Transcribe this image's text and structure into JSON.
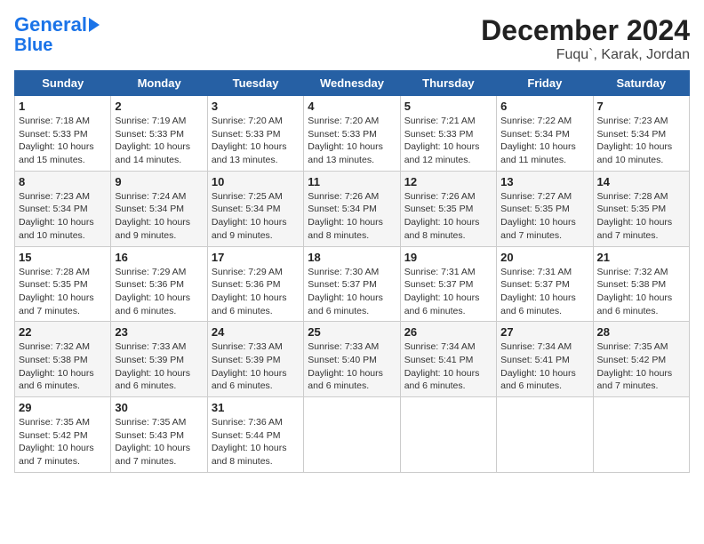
{
  "header": {
    "logo_line1": "General",
    "logo_line2": "Blue",
    "title": "December 2024",
    "subtitle": "Fuqu`, Karak, Jordan"
  },
  "calendar": {
    "days_of_week": [
      "Sunday",
      "Monday",
      "Tuesday",
      "Wednesday",
      "Thursday",
      "Friday",
      "Saturday"
    ],
    "weeks": [
      [
        null,
        {
          "day": "2",
          "sunrise": "7:19 AM",
          "sunset": "5:33 PM",
          "daylight": "10 hours and 14 minutes."
        },
        {
          "day": "3",
          "sunrise": "7:20 AM",
          "sunset": "5:33 PM",
          "daylight": "10 hours and 13 minutes."
        },
        {
          "day": "4",
          "sunrise": "7:20 AM",
          "sunset": "5:33 PM",
          "daylight": "10 hours and 13 minutes."
        },
        {
          "day": "5",
          "sunrise": "7:21 AM",
          "sunset": "5:33 PM",
          "daylight": "10 hours and 12 minutes."
        },
        {
          "day": "6",
          "sunrise": "7:22 AM",
          "sunset": "5:34 PM",
          "daylight": "10 hours and 11 minutes."
        },
        {
          "day": "7",
          "sunrise": "7:23 AM",
          "sunset": "5:34 PM",
          "daylight": "10 hours and 10 minutes."
        }
      ],
      [
        {
          "day": "1",
          "sunrise": "7:18 AM",
          "sunset": "5:33 PM",
          "daylight": "10 hours and 15 minutes."
        },
        null,
        null,
        null,
        null,
        null,
        null
      ],
      [
        {
          "day": "8",
          "sunrise": "7:23 AM",
          "sunset": "5:34 PM",
          "daylight": "10 hours and 10 minutes."
        },
        {
          "day": "9",
          "sunrise": "7:24 AM",
          "sunset": "5:34 PM",
          "daylight": "10 hours and 9 minutes."
        },
        {
          "day": "10",
          "sunrise": "7:25 AM",
          "sunset": "5:34 PM",
          "daylight": "10 hours and 9 minutes."
        },
        {
          "day": "11",
          "sunrise": "7:26 AM",
          "sunset": "5:34 PM",
          "daylight": "10 hours and 8 minutes."
        },
        {
          "day": "12",
          "sunrise": "7:26 AM",
          "sunset": "5:35 PM",
          "daylight": "10 hours and 8 minutes."
        },
        {
          "day": "13",
          "sunrise": "7:27 AM",
          "sunset": "5:35 PM",
          "daylight": "10 hours and 7 minutes."
        },
        {
          "day": "14",
          "sunrise": "7:28 AM",
          "sunset": "5:35 PM",
          "daylight": "10 hours and 7 minutes."
        }
      ],
      [
        {
          "day": "15",
          "sunrise": "7:28 AM",
          "sunset": "5:35 PM",
          "daylight": "10 hours and 7 minutes."
        },
        {
          "day": "16",
          "sunrise": "7:29 AM",
          "sunset": "5:36 PM",
          "daylight": "10 hours and 6 minutes."
        },
        {
          "day": "17",
          "sunrise": "7:29 AM",
          "sunset": "5:36 PM",
          "daylight": "10 hours and 6 minutes."
        },
        {
          "day": "18",
          "sunrise": "7:30 AM",
          "sunset": "5:37 PM",
          "daylight": "10 hours and 6 minutes."
        },
        {
          "day": "19",
          "sunrise": "7:31 AM",
          "sunset": "5:37 PM",
          "daylight": "10 hours and 6 minutes."
        },
        {
          "day": "20",
          "sunrise": "7:31 AM",
          "sunset": "5:37 PM",
          "daylight": "10 hours and 6 minutes."
        },
        {
          "day": "21",
          "sunrise": "7:32 AM",
          "sunset": "5:38 PM",
          "daylight": "10 hours and 6 minutes."
        }
      ],
      [
        {
          "day": "22",
          "sunrise": "7:32 AM",
          "sunset": "5:38 PM",
          "daylight": "10 hours and 6 minutes."
        },
        {
          "day": "23",
          "sunrise": "7:33 AM",
          "sunset": "5:39 PM",
          "daylight": "10 hours and 6 minutes."
        },
        {
          "day": "24",
          "sunrise": "7:33 AM",
          "sunset": "5:39 PM",
          "daylight": "10 hours and 6 minutes."
        },
        {
          "day": "25",
          "sunrise": "7:33 AM",
          "sunset": "5:40 PM",
          "daylight": "10 hours and 6 minutes."
        },
        {
          "day": "26",
          "sunrise": "7:34 AM",
          "sunset": "5:41 PM",
          "daylight": "10 hours and 6 minutes."
        },
        {
          "day": "27",
          "sunrise": "7:34 AM",
          "sunset": "5:41 PM",
          "daylight": "10 hours and 6 minutes."
        },
        {
          "day": "28",
          "sunrise": "7:35 AM",
          "sunset": "5:42 PM",
          "daylight": "10 hours and 7 minutes."
        }
      ],
      [
        {
          "day": "29",
          "sunrise": "7:35 AM",
          "sunset": "5:42 PM",
          "daylight": "10 hours and 7 minutes."
        },
        {
          "day": "30",
          "sunrise": "7:35 AM",
          "sunset": "5:43 PM",
          "daylight": "10 hours and 7 minutes."
        },
        {
          "day": "31",
          "sunrise": "7:36 AM",
          "sunset": "5:44 PM",
          "daylight": "10 hours and 8 minutes."
        },
        null,
        null,
        null,
        null
      ]
    ]
  }
}
